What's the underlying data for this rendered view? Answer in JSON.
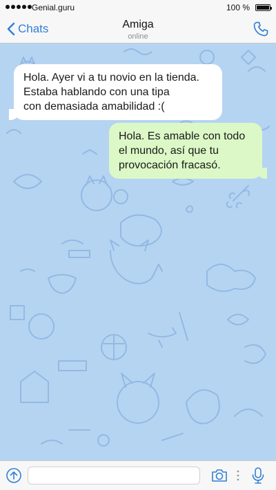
{
  "status_bar": {
    "carrier": "Genial.guru",
    "time": "",
    "battery": "100 %",
    "battery_level": 1.0
  },
  "header": {
    "back_label": "Chats",
    "contact_name": "Amiga",
    "contact_status": "online"
  },
  "messages": [
    {
      "direction": "incoming",
      "text": "Hola. Ayer vi a tu novio en la tienda.\nEstaba hablando con una tipa\ncon demasiada amabilidad :("
    },
    {
      "direction": "outgoing",
      "text": "Hola. Es amable con todo\nel mundo, así que tu\nprovocación fracasó."
    }
  ],
  "composer": {
    "value": "",
    "placeholder": ""
  },
  "icons": {
    "back": "chevron-left-icon",
    "call": "phone-icon",
    "attach": "upload-arrow-icon",
    "camera": "camera-icon",
    "more": "dots-icon",
    "mic": "microphone-icon"
  },
  "colors": {
    "accent": "#2f7fd8",
    "chat_background": "#b5d4f2",
    "incoming_bubble": "#ffffff",
    "outgoing_bubble": "#dcf8c6"
  }
}
